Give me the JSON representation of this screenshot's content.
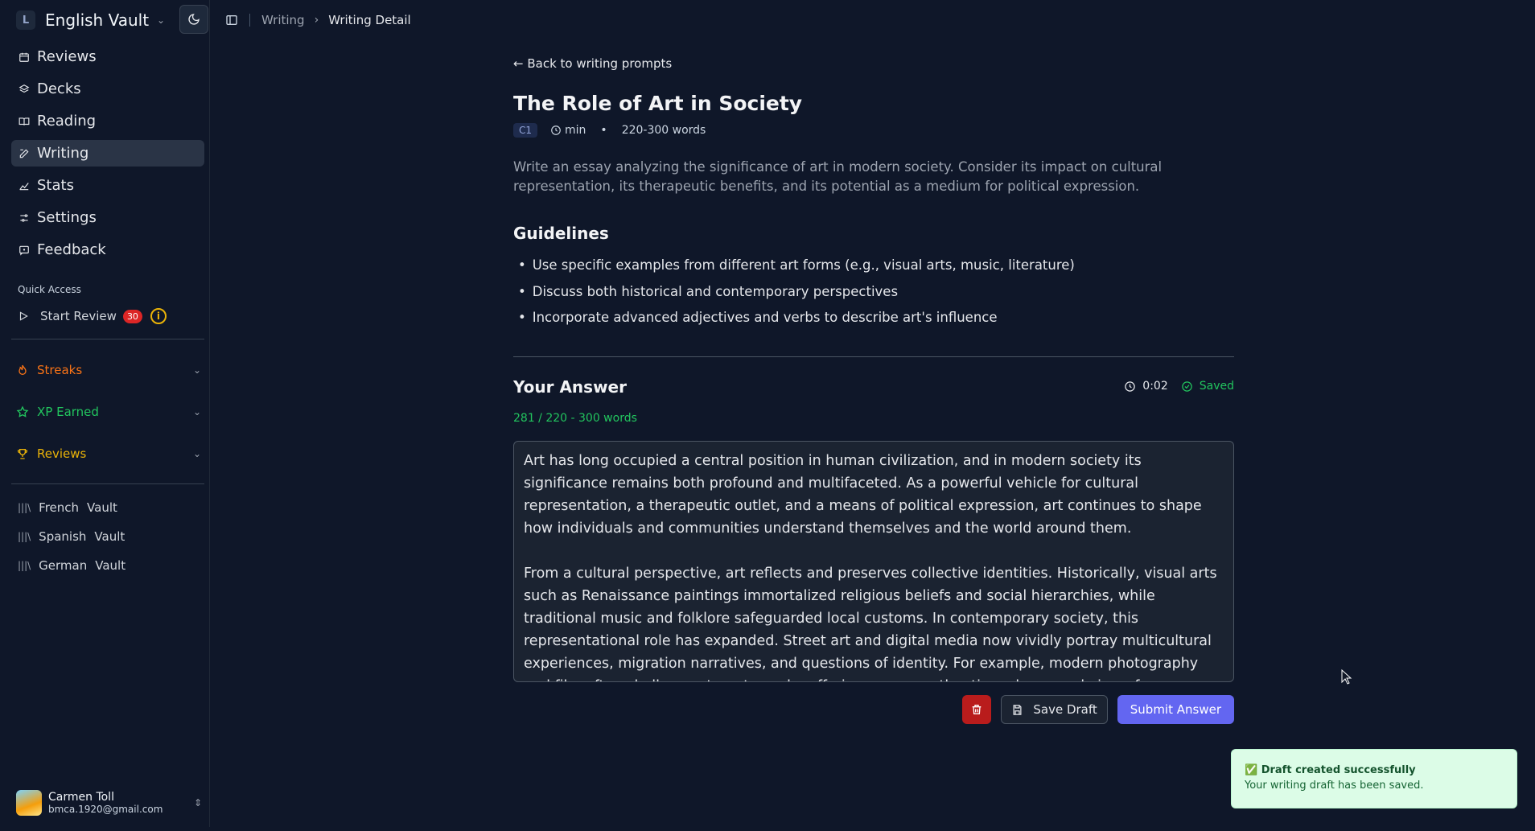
{
  "workspace": {
    "initial": "L",
    "name": "English Vault"
  },
  "nav": [
    {
      "label": "Reviews",
      "icon": "calendar-icon"
    },
    {
      "label": "Decks",
      "icon": "layers-icon"
    },
    {
      "label": "Reading",
      "icon": "book-icon"
    },
    {
      "label": "Writing",
      "icon": "edit-icon",
      "active": true
    },
    {
      "label": "Stats",
      "icon": "chart-icon"
    },
    {
      "label": "Settings",
      "icon": "sliders-icon"
    },
    {
      "label": "Feedback",
      "icon": "message-icon"
    }
  ],
  "quick_access": {
    "label": "Quick Access",
    "start_review": "Start Review",
    "count": "30",
    "info": "i"
  },
  "collapsibles": {
    "streaks": "Streaks",
    "xp": "XP Earned",
    "reviews": "Reviews"
  },
  "vaults": [
    {
      "lang": "French",
      "suffix": "Vault"
    },
    {
      "lang": "Spanish",
      "suffix": "Vault"
    },
    {
      "lang": "German",
      "suffix": "Vault"
    }
  ],
  "user": {
    "name": "Carmen Toll",
    "email": "bmca.1920@gmail.com"
  },
  "breadcrumb": {
    "parent": "Writing",
    "current": "Writing Detail"
  },
  "prompt": {
    "back_label": "← Back to writing prompts",
    "title": "The Role of Art in Society",
    "level": "C1",
    "time": "min",
    "word_range": "220-300 words",
    "description": "Write an essay analyzing the significance of art in modern society. Consider its impact on cultural representation, its therapeutic benefits, and its potential as a medium for political expression.",
    "guidelines_title": "Guidelines",
    "guidelines": [
      "Use specific examples from different art forms (e.g., visual arts, music, literature)",
      "Discuss both historical and contemporary perspectives",
      "Incorporate advanced adjectives and verbs to describe art's influence"
    ]
  },
  "answer": {
    "title": "Your Answer",
    "timer": "0:02",
    "status": "Saved",
    "word_count": "281 / 220 - 300 words",
    "text": "Art has long occupied a central position in human civilization, and in modern society its significance remains both profound and multifaceted. As a powerful vehicle for cultural representation, a therapeutic outlet, and a means of political expression, art continues to shape how individuals and communities understand themselves and the world around them.\n\nFrom a cultural perspective, art reflects and preserves collective identities. Historically, visual arts such as Renaissance paintings immortalized religious beliefs and social hierarchies, while traditional music and folklore safeguarded local customs. In contemporary society, this representational role has expanded. Street art and digital media now vividly portray multicultural experiences, migration narratives, and questions of identity. For example, modern photography and film often challenge stereotypes by offering a more authentic and nuanced view of underrepresented communities.",
    "save_label": "Save Draft",
    "submit_label": "Submit Answer"
  },
  "toast": {
    "title": "✅ Draft created successfully",
    "message": "Your writing draft has been saved."
  },
  "colors": {
    "background": "#0f1729",
    "accent": "#6366f1",
    "success": "#22c55e",
    "danger": "#b91c1c",
    "streaks": "#f97316",
    "xp": "#22c55e",
    "reviews": "#eab308"
  }
}
